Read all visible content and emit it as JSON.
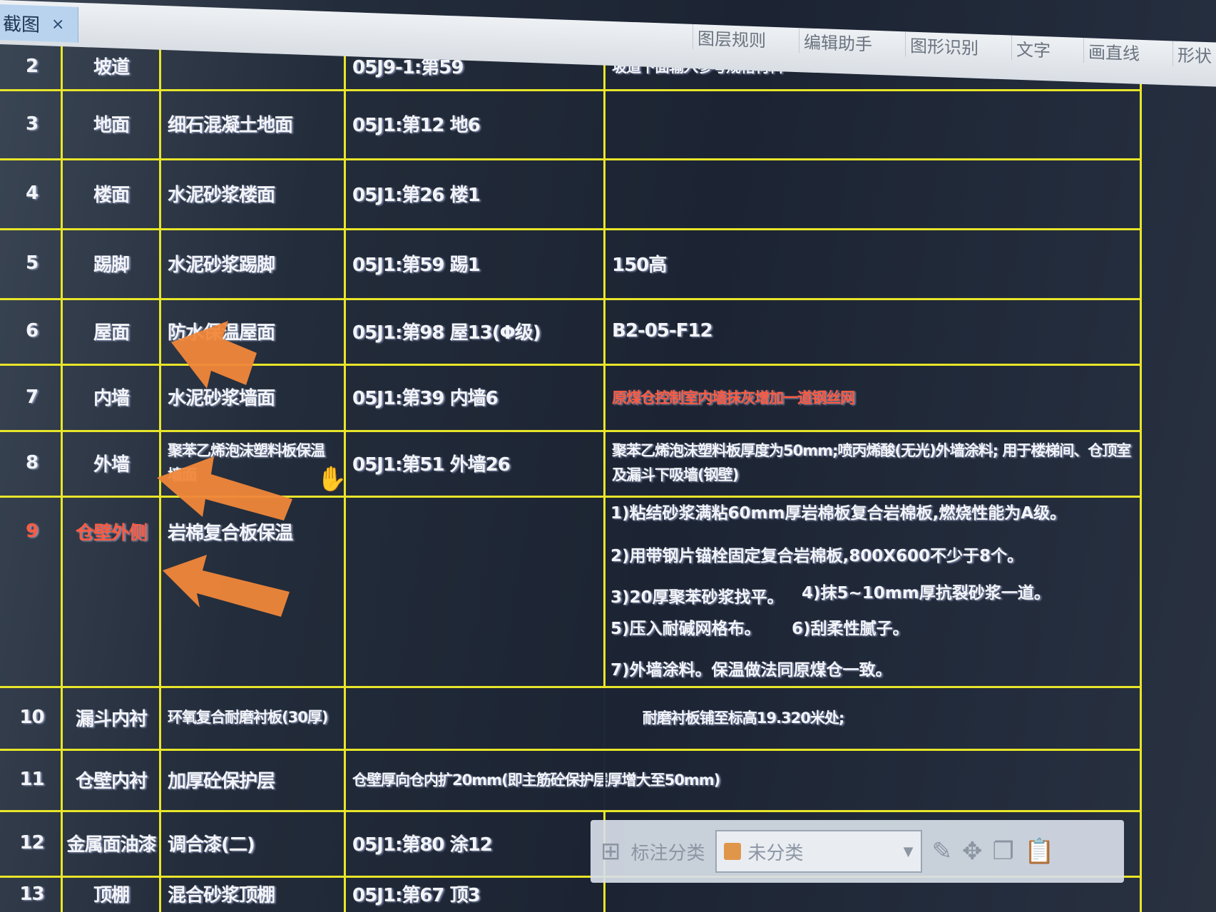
{
  "app": {
    "tab_label": "截图",
    "tab_close": "×",
    "menu": [
      "图层规则",
      "编辑助手",
      "图形识别",
      "文字",
      "画直线",
      "形状"
    ]
  },
  "colors": {
    "grid_line": "#e8e52a",
    "highlight_text": "#ff5a40",
    "arrow": "#f0873a",
    "category_swatch": "#e0964a"
  },
  "table": {
    "rows": [
      {
        "no": "2",
        "part": "坡道",
        "name": "",
        "ref": "05J9-1:第59",
        "note": "坡道下面输入参考规格材料"
      },
      {
        "no": "3",
        "part": "地面",
        "name": "细石混凝土地面",
        "ref": "05J1:第12 地6",
        "note": ""
      },
      {
        "no": "4",
        "part": "楼面",
        "name": "水泥砂浆楼面",
        "ref": "05J1:第26 楼1",
        "note": ""
      },
      {
        "no": "5",
        "part": "踢脚",
        "name": "水泥砂浆踢脚",
        "ref": "05J1:第59 踢1",
        "note": "150高"
      },
      {
        "no": "6",
        "part": "屋面",
        "name": "防水保温屋面",
        "ref": "05J1:第98 屋13(Φ级)",
        "note": "B2-05-F12"
      },
      {
        "no": "7",
        "part": "内墙",
        "name": "水泥砂浆墙面",
        "ref": "05J1:第39 内墙6",
        "note": "原煤仓控制室内墙抹灰增加一道钢丝网"
      },
      {
        "no": "8",
        "part": "外墙",
        "name": "聚苯乙烯泡沫塑料板保温墙面",
        "ref": "05J1:第51 外墙26",
        "note": "聚苯乙烯泡沫塑料板厚度为50mm;喷丙烯酸(无光)外墙涂料; 用于楼梯间、仓顶室及漏斗下吸墙(钢壁)"
      },
      {
        "no": "9",
        "part": "仓壁外侧",
        "name": "岩棉复合板保温",
        "ref": "",
        "note_list": [
          "1)粘结砂浆满粘60mm厚岩棉板复合岩棉板,燃烧性能为A级。",
          "2)用带钢片锚栓固定复合岩棉板,800X600不少于8个。",
          "3)20厚聚苯砂浆找平。",
          "4)抹5~10mm厚抗裂砂浆一道。",
          "5)压入耐碱网格布。",
          "6)刮柔性腻子。",
          "7)外墙涂料。保温做法同原煤仓一致。"
        ]
      },
      {
        "no": "10",
        "part": "漏斗内衬",
        "name": "环氧复合耐磨衬板(30厚)",
        "ref": "耐磨衬板铺至标高19.320米处;",
        "note": ""
      },
      {
        "no": "11",
        "part": "仓壁内衬",
        "name": "加厚砼保护层",
        "ref": "仓壁厚向仓内扩20mm(即主筋砼保护层厚增大至50mm)",
        "note": ""
      },
      {
        "no": "12",
        "part": "金属面油漆",
        "name": "调合漆(二)",
        "ref": "05J1:第80 涂12",
        "note": ""
      },
      {
        "no": "13",
        "part": "顶棚",
        "name": "混合砂浆顶棚",
        "ref": "05J1:第67 顶3",
        "note": ""
      }
    ]
  },
  "toolbar": {
    "label": "标注分类",
    "category_value": "未分类",
    "icons": [
      "grid-icon",
      "edit-icon",
      "move-icon",
      "copy-icon",
      "paste-icon"
    ]
  }
}
